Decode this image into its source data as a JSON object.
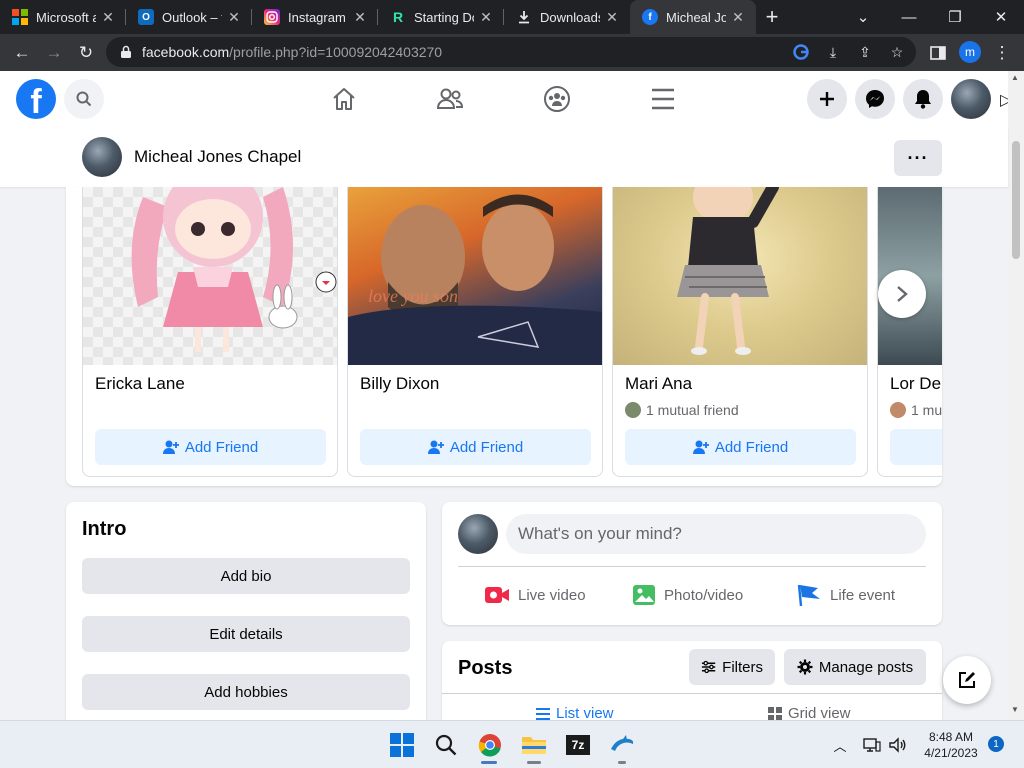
{
  "browser": {
    "tabs": [
      {
        "title": "Microsoft a",
        "icon": "microsoft-icon"
      },
      {
        "title": "Outlook – f",
        "icon": "outlook-icon"
      },
      {
        "title": "Instagram •",
        "icon": "instagram-icon"
      },
      {
        "title": "Starting Do",
        "icon": "replit-icon"
      },
      {
        "title": "Downloads",
        "icon": "download-icon"
      },
      {
        "title": "Micheal Jon",
        "icon": "facebook-icon"
      }
    ],
    "url_host": "facebook.com",
    "url_path": "/profile.php?id=100092042403270",
    "profile_initial": "m"
  },
  "profile": {
    "name": "Micheal Jones Chapel",
    "more_label": "···"
  },
  "people": [
    {
      "name": "Ericka Lane",
      "mutual": "",
      "button": "Add Friend"
    },
    {
      "name": "Billy Dixon",
      "mutual": "",
      "button": "Add Friend"
    },
    {
      "name": "Mari Ana",
      "mutual": "1 mutual friend",
      "button": "Add Friend"
    },
    {
      "name": "Lor De",
      "mutual": "1 mu",
      "button": ""
    }
  ],
  "intro": {
    "title": "Intro",
    "buttons": [
      "Add bio",
      "Edit details",
      "Add hobbies"
    ]
  },
  "composer": {
    "placeholder": "What's on your mind?",
    "actions": [
      "Live video",
      "Photo/video",
      "Life event"
    ]
  },
  "posts": {
    "title": "Posts",
    "filters": "Filters",
    "manage": "Manage posts",
    "list_view": "List view",
    "grid_view": "Grid view"
  },
  "taskbar": {
    "time": "8:48 AM",
    "date": "4/21/2023",
    "notifications": "1"
  },
  "colors": {
    "facebook_blue": "#1877f2",
    "add_friend_bg": "#e7f3ff",
    "page_bg": "#f0f2f5"
  }
}
